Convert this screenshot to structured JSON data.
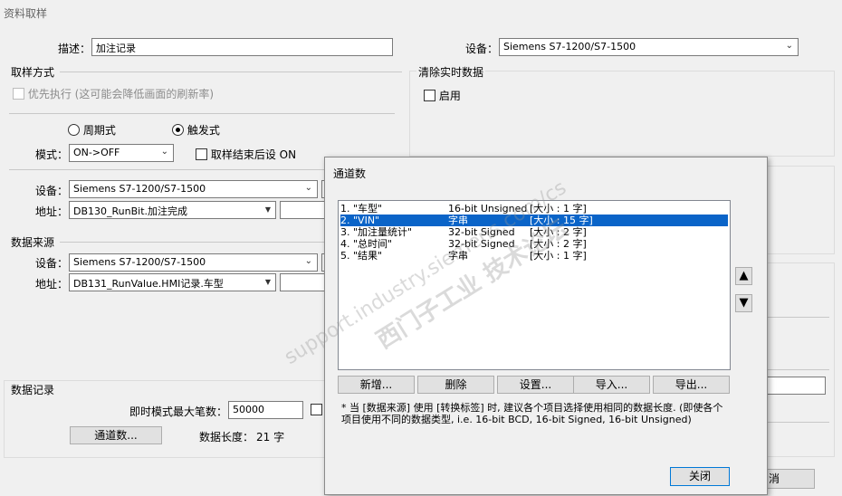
{
  "window": {
    "title": "资料取样"
  },
  "top": {
    "desc_label": "描述：",
    "desc_value": "加注记录",
    "device_label": "设备：",
    "device_value": "Siemens S7-1200/S7-1500"
  },
  "sampling": {
    "section_title": "取样方式",
    "priority_label": "优先执行 (这可能会降低画面的刷新率)",
    "periodic_label": "周期式",
    "trigger_label": "触发式",
    "mode_label": "模式：",
    "mode_value": "ON->OFF",
    "set_on_label": "取样结束后设 ON",
    "device_label": "设备：",
    "device_value": "Siemens S7-1200/S7-1500",
    "address_label": "地址：",
    "address_value": "DB130_RunBit.加注完成"
  },
  "source": {
    "section_title": "数据来源",
    "device_label": "设备：",
    "device_value": "Siemens S7-1200/S7-1500",
    "address_label": "地址：",
    "address_value": "DB131_RunValue.HMI记录.车型"
  },
  "record": {
    "section_title": "数据记录",
    "max_label": "即时模式最大笔数：",
    "max_value": "50000",
    "channels_button": "通道数...",
    "length_label": "数据长度：",
    "length_value": "21 字"
  },
  "clear": {
    "section_title": "清除实时数据",
    "enable_label": "启用"
  },
  "cancel_fragment": "消",
  "dialog": {
    "title": "通道数",
    "rows": [
      {
        "name": "1. \"车型\"",
        "type": "16-bit Unsigned",
        "size": "[大小 : 1 字]",
        "selected": false
      },
      {
        "name": "2. \"VIN\"",
        "type": "字串",
        "size": "[大小 : 15 字]",
        "selected": true
      },
      {
        "name": "3. \"加注量统计\"",
        "type": "32-bit Signed",
        "size": "[大小 : 2 字]",
        "selected": false
      },
      {
        "name": "4. \"总时间\"",
        "type": "32-bit Signed",
        "size": "[大小 : 2 字]",
        "selected": false
      },
      {
        "name": "5. \"结果\"",
        "type": "字串",
        "size": "[大小 : 1 字]",
        "selected": false
      }
    ],
    "buttons": {
      "add": "新增...",
      "delete": "删除",
      "settings": "设置...",
      "import": "导入...",
      "export": "导出..."
    },
    "note": "* 当 [数据来源] 使用 [转换标签] 时, 建议各个项目选择使用相同的数据长度. (即使各个项目使用不同的数据类型, i.e. 16-bit BCD, 16-bit Signed, 16-bit Unsigned)",
    "close": "关闭"
  },
  "watermark": {
    "cn": "西门子工业 技术论坛",
    "en": "support.industry.siemens.com/cs"
  }
}
